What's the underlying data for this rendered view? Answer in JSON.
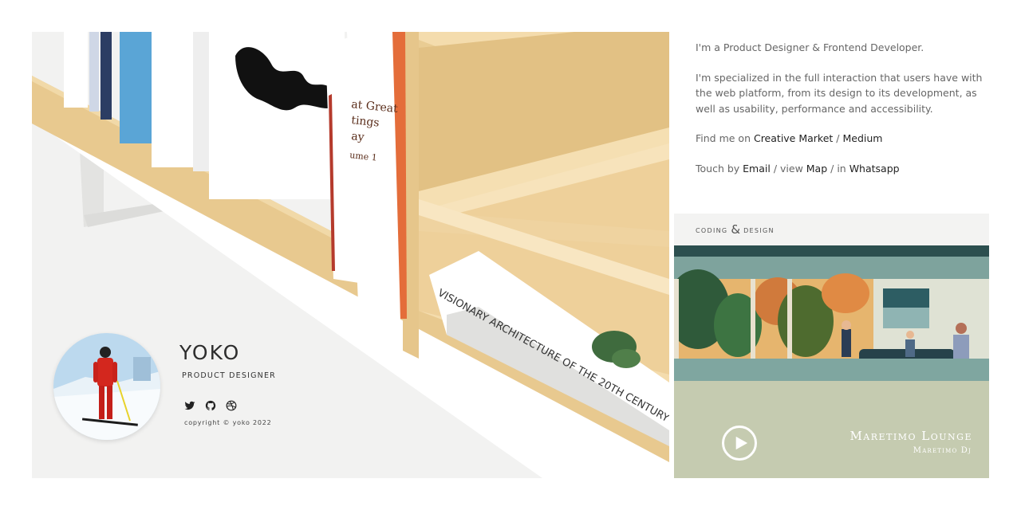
{
  "profile": {
    "name": "YOKO",
    "role": "PRODUCT DESIGNER",
    "copyright": "copyright © yoko 2022",
    "social_icons": [
      "twitter-icon",
      "github-icon",
      "dribbble-icon"
    ]
  },
  "about": {
    "intro": "I'm a Product Designer & Frontend Developer.",
    "description": "I'm specialized in the full interaction that users have with the web platform, from its design to its development, as well as usability, performance and accessibility.",
    "find_prefix": "Find me on ",
    "find_link_1": "Creative Market",
    "find_sep": " / ",
    "find_link_2": "Medium",
    "touch_prefix": "Touch by ",
    "touch_link_email": "Email",
    "touch_sep_1": " / view ",
    "touch_link_map": "Map",
    "touch_sep_2": " / in ",
    "touch_link_whatsapp": "Whatsapp"
  },
  "card": {
    "header_left": "coding",
    "header_amp": "&",
    "header_right": "design",
    "track_title": "Maretimo Lounge",
    "track_artist": "Maretimo Dj",
    "play_icon": "play-icon"
  },
  "colors": {
    "accent_text": "#222222",
    "muted_text": "#666666",
    "card_bg": "#c5cbb0",
    "card_header_bg": "#f3f3f2"
  }
}
